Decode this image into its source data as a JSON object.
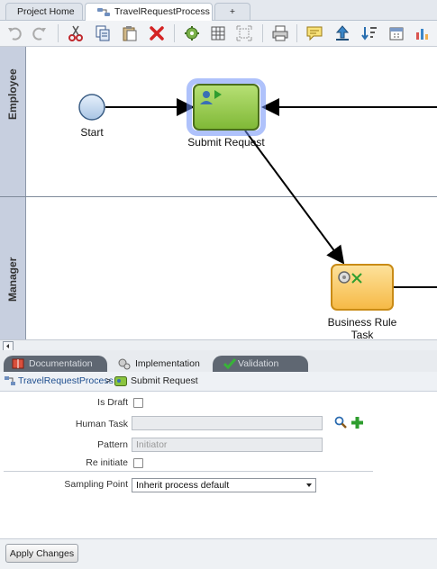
{
  "tabs": [
    {
      "label": "Project Home"
    },
    {
      "label": "TravelRequestProcess"
    },
    {
      "label": "+"
    }
  ],
  "toolbar": {
    "icons": [
      "undo-icon",
      "redo-icon",
      "cut-icon",
      "copy-icon",
      "paste-icon",
      "delete-icon",
      "validate-icon",
      "grid-icon",
      "fit-icon",
      "print-icon",
      "comment-icon",
      "publish-icon",
      "sort-icon",
      "calendar-icon",
      "chart-icon"
    ]
  },
  "lanes": {
    "employee": "Employee",
    "manager": "Manager"
  },
  "nodes": {
    "start": "Start",
    "submit": "Submit Request",
    "business_rule": "Business Rule Task"
  },
  "property_tabs": {
    "documentation": "Documentation",
    "implementation": "Implementation",
    "validation": "Validation"
  },
  "breadcrumb": {
    "process": "TravelRequestProcess",
    "sep": ">",
    "activity": "Submit Request"
  },
  "form": {
    "is_draft_label": "Is Draft",
    "human_task_label": "Human Task",
    "human_task_value": "",
    "pattern_label": "Pattern",
    "pattern_value": "Initiator",
    "reinitiate_label": "Re initiate",
    "sampling_label": "Sampling Point",
    "sampling_value": "Inherit process default"
  },
  "apply_label": "Apply Changes",
  "colors": {
    "lane_header": "#c7cfdf",
    "task_green": "#8ac43f",
    "rule_orange": "#fbc95f"
  }
}
